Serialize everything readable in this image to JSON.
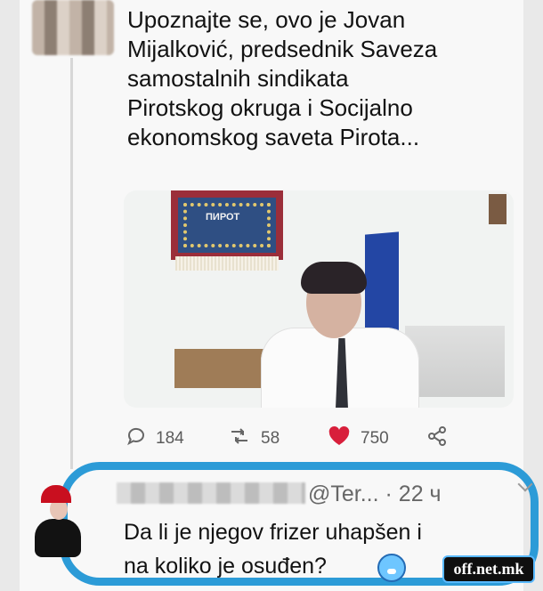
{
  "tweet": {
    "text": "Upoznajte se, ovo je Jovan\nMijalković, predsednik Saveza\nsamostalnih sindikata\nPirotskog okruga i Socijalno\nekonomskog saveta Pirota..."
  },
  "photo": {
    "sign_text": "ПИРОТ"
  },
  "actions": {
    "reply_icon": "comment-icon",
    "reply_count": "184",
    "retweet_icon": "retweet-icon",
    "retweet_count": "58",
    "like_icon": "heart-icon",
    "like_count": "750",
    "share_icon": "share-icon"
  },
  "reply": {
    "handle": "@Ter...",
    "time": "· 22 ч",
    "text": "Da li je njegov frizer uhapšen i\nna koliko je osuđen?",
    "emoji": "😱"
  },
  "watermark": {
    "text": "off.net.mk"
  },
  "colors": {
    "accent_blue": "#2c9bd7",
    "like_red": "#d81f3b",
    "text": "#121212",
    "muted": "#5b5b5b"
  }
}
